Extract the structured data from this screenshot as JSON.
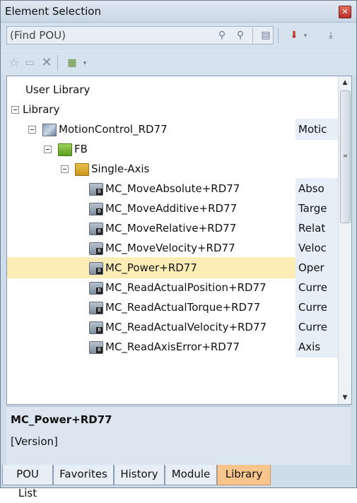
{
  "window": {
    "title": "Element Selection"
  },
  "find": {
    "placeholder": "(Find POU)"
  },
  "icons": {
    "close": "close-icon",
    "find_next": "binoculars-icon",
    "find_prev": "binoculars-back-icon",
    "favorites": "star-icon",
    "new_folder": "folder-icon",
    "delete": "x-icon"
  },
  "tree": {
    "user_library": "User Library",
    "library": "Library",
    "motion_control": {
      "label": "MotionControl_RD77",
      "desc": "Motic"
    },
    "fb": "FB",
    "single_axis": "Single-Axis",
    "items": [
      {
        "label": "MC_MoveAbsolute+RD77",
        "desc": "Abso"
      },
      {
        "label": "MC_MoveAdditive+RD77",
        "desc": "Targe"
      },
      {
        "label": "MC_MoveRelative+RD77",
        "desc": "Relat"
      },
      {
        "label": "MC_MoveVelocity+RD77",
        "desc": "Veloc"
      },
      {
        "label": "MC_Power+RD77",
        "desc": "Oper"
      },
      {
        "label": "MC_ReadActualPosition+RD77",
        "desc": "Curre"
      },
      {
        "label": "MC_ReadActualTorque+RD77",
        "desc": "Curre"
      },
      {
        "label": "MC_ReadActualVelocity+RD77",
        "desc": "Curre"
      },
      {
        "label": "MC_ReadAxisError+RD77",
        "desc": "Axis"
      }
    ]
  },
  "info": {
    "name": "MC_Power+RD77",
    "version": "[Version]"
  },
  "tabs": [
    "POU List",
    "Favorites",
    "History",
    "Module",
    "Library"
  ],
  "active_tab": "Library",
  "colors": {
    "selected_row": "#fbedb5",
    "active_tab": "#f8c58c",
    "panel": "#cfdcea"
  }
}
